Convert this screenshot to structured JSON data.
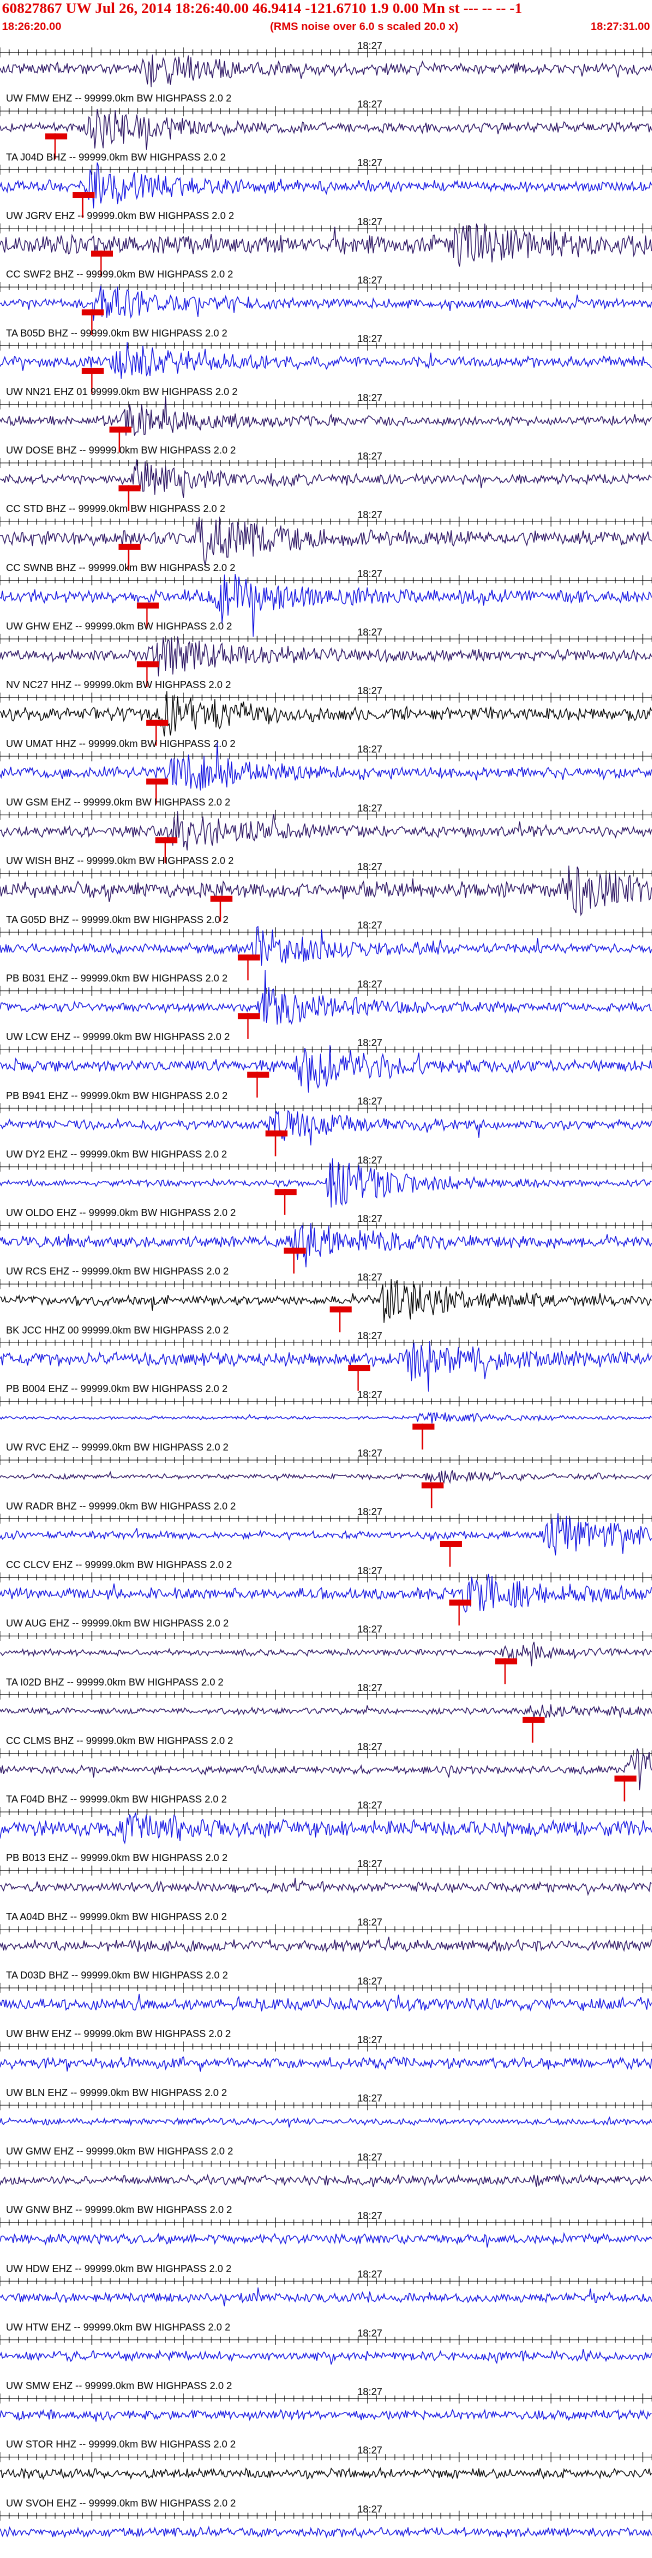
{
  "header": {
    "title": "60827867 UW Jul 26, 2014 18:26:40.00   46.9414 -121.6710  1.9 0.00 Mn st --- -- --  -1",
    "start_time": "18:26:20.00",
    "rms_note": "(RMS noise over 6.0 s scaled 20.0 x)",
    "end_time": "18:27:31.00"
  },
  "colors": {
    "header_red": "#e00000",
    "pick_red": "#e00000",
    "trace_blue": "#1010e0",
    "trace_dark": "#281060",
    "trace_black": "#000000"
  },
  "chart_data": {
    "type": "seismogram",
    "time_start": "18:26:20.00",
    "time_end": "18:27:31.00",
    "tick_label": "18:27",
    "tick_time_s": 40,
    "duration_s": 71,
    "traces": [
      {
        "label": "",
        "color": "dark",
        "amp": 0.35,
        "burst_t": 16,
        "burst_amp": 0.8,
        "pick_t": null
      },
      {
        "label": "UW FMW EHZ -- 99999.0km BW  HIGHPASS  2.0  2",
        "color": "dark",
        "amp": 0.3,
        "burst_t": 10,
        "burst_amp": 1.0,
        "pick_t": 6
      },
      {
        "label": "TA J04D BHZ -- 99999.0km BW  HIGHPASS  2.0  2",
        "color": "blue",
        "amp": 0.35,
        "burst_t": 10,
        "burst_amp": 1.1,
        "pick_t": 9
      },
      {
        "label": "UW JGRV EHZ -- 99999.0km BW  HIGHPASS  2.0  2",
        "color": "dark",
        "amp": 0.6,
        "burst_t": 50,
        "burst_amp": 0.9,
        "pick_t": 11
      },
      {
        "label": "CC SWF2 BHZ -- 99999.0km BW  HIGHPASS  2.0  2",
        "color": "blue",
        "amp": 0.3,
        "burst_t": 11,
        "burst_amp": 0.8,
        "pick_t": 10
      },
      {
        "label": "TA B05D BHZ -- 99999.0km BW  HIGHPASS  2.0  2",
        "color": "blue",
        "amp": 0.35,
        "burst_t": 13,
        "burst_amp": 0.9,
        "pick_t": 10
      },
      {
        "label": "UW NN21 EHZ 01 99999.0km BW  HIGHPASS  2.0  2",
        "color": "dark",
        "amp": 0.3,
        "burst_t": 14,
        "burst_amp": 0.8,
        "pick_t": 13
      },
      {
        "label": "UW DOSE BHZ -- 99999.0km BW  HIGHPASS  2.0  2",
        "color": "dark",
        "amp": 0.3,
        "burst_t": 15,
        "burst_amp": 0.9,
        "pick_t": 14
      },
      {
        "label": "CC STD BHZ -- 99999.0km BW  HIGHPASS  2.0  2",
        "color": "dark",
        "amp": 0.45,
        "burst_t": 22,
        "burst_amp": 1.2,
        "pick_t": 14
      },
      {
        "label": "CC SWNB BHZ -- 99999.0km BW  HIGHPASS  2.0  2",
        "color": "blue",
        "amp": 0.4,
        "burst_t": 24,
        "burst_amp": 1.1,
        "pick_t": 16
      },
      {
        "label": "UW GHW EHZ -- 99999.0km BW  HIGHPASS  2.0  2",
        "color": "dark",
        "amp": 0.35,
        "burst_t": 17,
        "burst_amp": 1.0,
        "pick_t": 16
      },
      {
        "label": "NV NC27 HHZ -- 99999.0km BW  HIGHPASS  2.0  2",
        "color": "black",
        "amp": 0.4,
        "burst_t": 18,
        "burst_amp": 1.0,
        "pick_t": 17
      },
      {
        "label": "UW UMAT HHZ -- 99999.0km BW  HIGHPASS  2.0  2",
        "color": "blue",
        "amp": 0.35,
        "burst_t": 19,
        "burst_amp": 1.0,
        "pick_t": 17
      },
      {
        "label": "UW GSM EHZ -- 99999.0km BW  HIGHPASS  2.0  2",
        "color": "dark",
        "amp": 0.35,
        "burst_t": 19,
        "burst_amp": 0.9,
        "pick_t": 18
      },
      {
        "label": "UW WISH BHZ -- 99999.0km BW  HIGHPASS  2.0  2",
        "color": "dark",
        "amp": 0.5,
        "burst_t": 62,
        "burst_amp": 1.1,
        "pick_t": 24
      },
      {
        "label": "TA G05D BHZ -- 99999.0km BW  HIGHPASS  2.0  2",
        "color": "blue",
        "amp": 0.3,
        "burst_t": 28,
        "burst_amp": 1.0,
        "pick_t": 27
      },
      {
        "label": "PB B031 EHZ -- 99999.0km BW  HIGHPASS  2.0  2",
        "color": "blue",
        "amp": 0.3,
        "burst_t": 29,
        "burst_amp": 1.0,
        "pick_t": 27
      },
      {
        "label": "UW LCW EHZ -- 99999.0km BW  HIGHPASS  2.0  2",
        "color": "blue",
        "amp": 0.35,
        "burst_t": 33,
        "burst_amp": 1.2,
        "pick_t": 28
      },
      {
        "label": "PB B941 EHZ -- 99999.0km BW  HIGHPASS  2.0  2",
        "color": "blue",
        "amp": 0.3,
        "burst_t": 30,
        "burst_amp": 0.7,
        "pick_t": 30
      },
      {
        "label": "UW DY2 EHZ -- 99999.0km BW  HIGHPASS  2.0  2",
        "color": "blue",
        "amp": 0.2,
        "burst_t": 36,
        "burst_amp": 1.3,
        "pick_t": 31
      },
      {
        "label": "UW OLDO EHZ -- 99999.0km BW  HIGHPASS  2.0  2",
        "color": "blue",
        "amp": 0.35,
        "burst_t": 32,
        "burst_amp": 1.0,
        "pick_t": 32
      },
      {
        "label": "UW RCS EHZ -- 99999.0km BW  HIGHPASS  2.0  2",
        "color": "black",
        "amp": 0.3,
        "burst_t": 42,
        "burst_amp": 1.2,
        "pick_t": 37
      },
      {
        "label": "BK JCC HHZ 00 99999.0km BW  HIGHPASS  2.0  2",
        "color": "blue",
        "amp": 0.4,
        "burst_t": 45,
        "burst_amp": 1.0,
        "pick_t": 39
      },
      {
        "label": "PB B004 EHZ -- 99999.0km BW  HIGHPASS  2.0  2",
        "color": "blue",
        "amp": 0.1,
        "burst_t": 46,
        "burst_amp": 0.3,
        "pick_t": 46
      },
      {
        "label": "UW RVC EHZ -- 99999.0km BW  HIGHPASS  2.0  2",
        "color": "dark",
        "amp": 0.15,
        "burst_t": 47,
        "burst_amp": 0.3,
        "pick_t": 47
      },
      {
        "label": "UW RADR BHZ -- 99999.0km BW  HIGHPASS  2.0  2",
        "color": "blue",
        "amp": 0.25,
        "burst_t": 60,
        "burst_amp": 1.3,
        "pick_t": 49
      },
      {
        "label": "CC CLCV EHZ -- 99999.0km BW  HIGHPASS  2.0  2",
        "color": "blue",
        "amp": 0.35,
        "burst_t": 51,
        "burst_amp": 1.0,
        "pick_t": 50
      },
      {
        "label": "UW AUG EHZ -- 99999.0km BW  HIGHPASS  2.0  2",
        "color": "dark",
        "amp": 0.2,
        "burst_t": 55,
        "burst_amp": 0.3,
        "pick_t": 55
      },
      {
        "label": "TA I02D BHZ -- 99999.0km BW  HIGHPASS  2.0  2",
        "color": "dark",
        "amp": 0.2,
        "burst_t": 58,
        "burst_amp": 0.3,
        "pick_t": 58
      },
      {
        "label": "CC CLMS BHZ -- 99999.0km BW  HIGHPASS  2.0  2",
        "color": "dark",
        "amp": 0.25,
        "burst_t": 69,
        "burst_amp": 1.2,
        "pick_t": 68
      },
      {
        "label": "TA F04D BHZ -- 99999.0km BW  HIGHPASS  2.0  2",
        "color": "blue",
        "amp": 0.5,
        "burst_t": 14,
        "burst_amp": 0.6,
        "pick_t": null
      },
      {
        "label": "PB B013 EHZ -- 99999.0km BW  HIGHPASS  2.0  2",
        "color": "dark",
        "amp": 0.3,
        "burst_t": null,
        "burst_amp": 0,
        "pick_t": null
      },
      {
        "label": "TA A04D BHZ -- 99999.0km BW  HIGHPASS  2.0  2",
        "color": "dark",
        "amp": 0.35,
        "burst_t": null,
        "burst_amp": 0,
        "pick_t": null
      },
      {
        "label": "TA D03D BHZ -- 99999.0km BW  HIGHPASS  2.0  2",
        "color": "blue",
        "amp": 0.4,
        "burst_t": null,
        "burst_amp": 0,
        "pick_t": null
      },
      {
        "label": "UW BHW EHZ -- 99999.0km BW  HIGHPASS  2.0  2",
        "color": "blue",
        "amp": 0.35,
        "burst_t": null,
        "burst_amp": 0,
        "pick_t": null
      },
      {
        "label": "UW BLN EHZ -- 99999.0km BW  HIGHPASS  2.0  2",
        "color": "blue",
        "amp": 0.2,
        "burst_t": null,
        "burst_amp": 0,
        "pick_t": null
      },
      {
        "label": "UW GMW EHZ -- 99999.0km BW  HIGHPASS  2.0  2",
        "color": "dark",
        "amp": 0.3,
        "burst_t": null,
        "burst_amp": 0,
        "pick_t": null
      },
      {
        "label": "UW GNW BHZ -- 99999.0km BW  HIGHPASS  2.0  2",
        "color": "blue",
        "amp": 0.3,
        "burst_t": null,
        "burst_amp": 0,
        "pick_t": null
      },
      {
        "label": "UW HDW EHZ -- 99999.0km BW  HIGHPASS  2.0  2",
        "color": "blue",
        "amp": 0.3,
        "burst_t": null,
        "burst_amp": 0,
        "pick_t": null
      },
      {
        "label": "UW HTW EHZ -- 99999.0km BW  HIGHPASS  2.0  2",
        "color": "blue",
        "amp": 0.3,
        "burst_t": null,
        "burst_amp": 0,
        "pick_t": null
      },
      {
        "label": "UW SMW EHZ -- 99999.0km BW  HIGHPASS  2.0  2",
        "color": "blue",
        "amp": 0.3,
        "burst_t": null,
        "burst_amp": 0,
        "pick_t": null
      },
      {
        "label": "UW STOR HHZ -- 99999.0km BW  HIGHPASS  2.0  2",
        "color": "black",
        "amp": 0.3,
        "burst_t": null,
        "burst_amp": 0,
        "pick_t": null
      },
      {
        "label": "UW SVOH EHZ -- 99999.0km BW  HIGHPASS  2.0  2",
        "color": "blue",
        "amp": 0.3,
        "burst_t": null,
        "burst_amp": 0,
        "pick_t": null
      }
    ]
  }
}
